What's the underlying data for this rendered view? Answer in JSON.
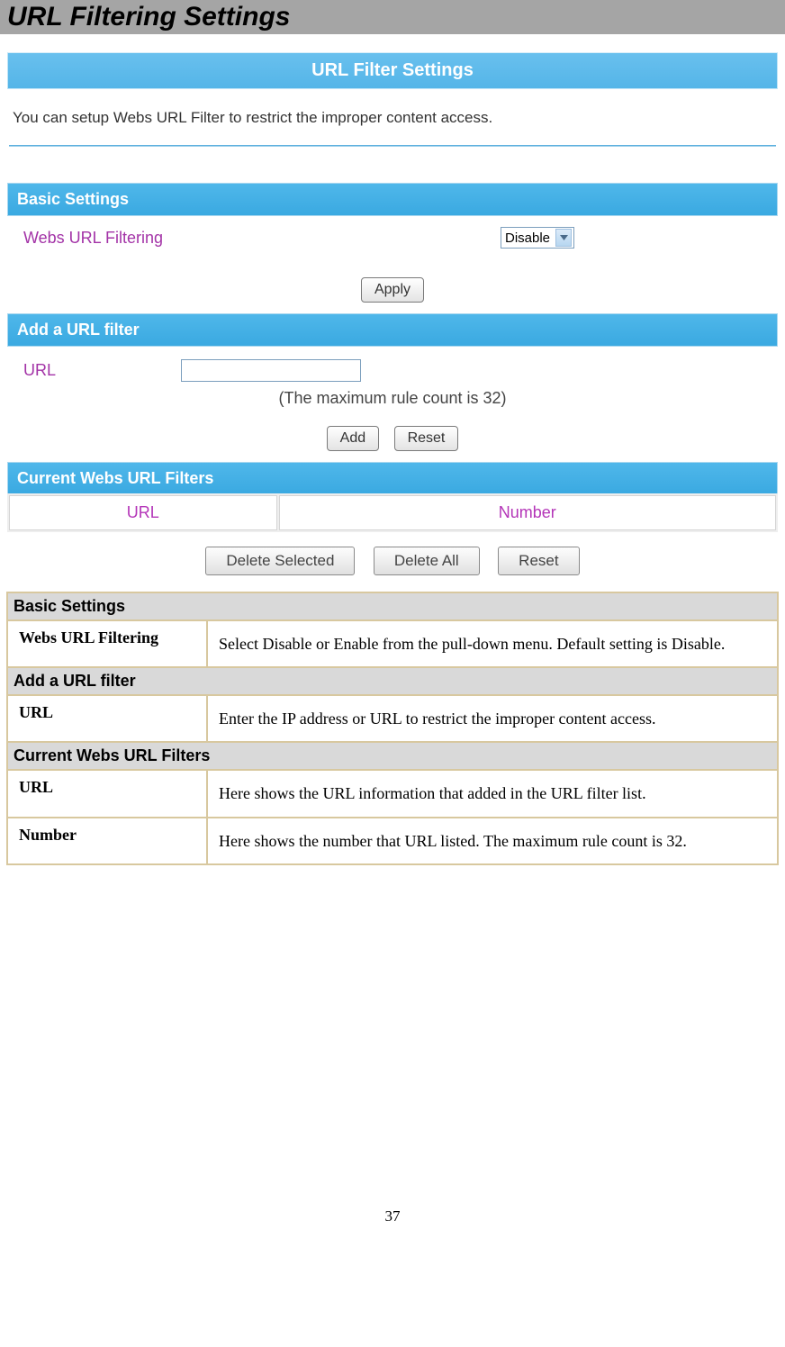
{
  "pageTitle": "URL Filtering Settings",
  "bannerTitle": "URL Filter Settings",
  "description": "You can setup Webs URL Filter to restrict the improper content access.",
  "basicSettings": {
    "header": "Basic Settings",
    "label": "Webs URL Filtering",
    "dropdownValue": "Disable",
    "applyLabel": "Apply"
  },
  "addFilter": {
    "header": "Add a URL filter",
    "label": "URL",
    "maxNote": "(The maximum rule count is 32)",
    "addLabel": "Add",
    "resetLabel": "Reset"
  },
  "currentFilters": {
    "header": "Current Webs URL Filters",
    "col1": "URL",
    "col2": "Number",
    "deleteSelected": "Delete Selected",
    "deleteAll": "Delete All",
    "reset": "Reset"
  },
  "descTable": {
    "section1": {
      "header": "Basic Settings",
      "row1Label": "Webs URL Filtering",
      "row1Desc": "Select Disable or Enable from the pull-down menu. Default setting is Disable."
    },
    "section2": {
      "header": "Add a URL filter",
      "row1Label": "URL",
      "row1Desc": "Enter the IP address or URL to restrict the improper content access."
    },
    "section3": {
      "header": "Current Webs URL Filters",
      "row1Label": "URL",
      "row1Desc": "Here shows the URL information that added in the URL filter list.",
      "row2Label": "Number",
      "row2Desc": "Here shows the number that URL listed. The maximum rule count is 32."
    }
  },
  "pageNumber": "37"
}
